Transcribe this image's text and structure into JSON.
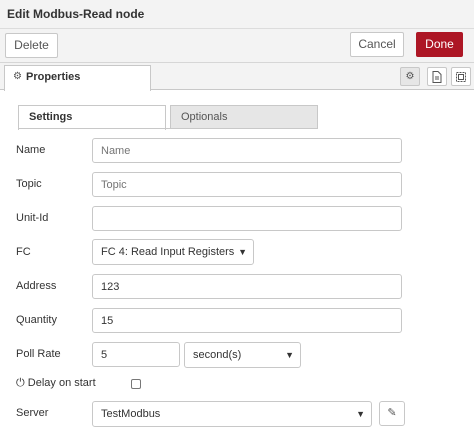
{
  "dialog": {
    "title": "Edit Modbus-Read node"
  },
  "toolbar": {
    "delete_label": "Delete",
    "cancel_label": "Cancel",
    "done_label": "Done",
    "done_color": "#ad1625"
  },
  "tabs": {
    "properties_label": "Properties",
    "icons": [
      "gear-icon",
      "description-icon",
      "appearance-icon"
    ]
  },
  "subtabs": {
    "settings": "Settings",
    "optionals": "Optionals"
  },
  "form": {
    "name": {
      "label": "Name",
      "value": "",
      "placeholder": "Name"
    },
    "topic": {
      "label": "Topic",
      "value": "",
      "placeholder": "Topic"
    },
    "unit_id": {
      "label": "Unit-Id",
      "value": ""
    },
    "fc": {
      "label": "FC",
      "selected": "FC 4: Read Input Registers"
    },
    "address": {
      "label": "Address",
      "value": "123"
    },
    "quantity": {
      "label": "Quantity",
      "value": "15"
    },
    "poll_rate": {
      "label": "Poll Rate",
      "value": "5",
      "unit_selected": "second(s)"
    },
    "delay_on_start": {
      "label": "Delay on start",
      "checked": false
    },
    "server": {
      "label": "Server",
      "selected": "TestModbus"
    }
  }
}
